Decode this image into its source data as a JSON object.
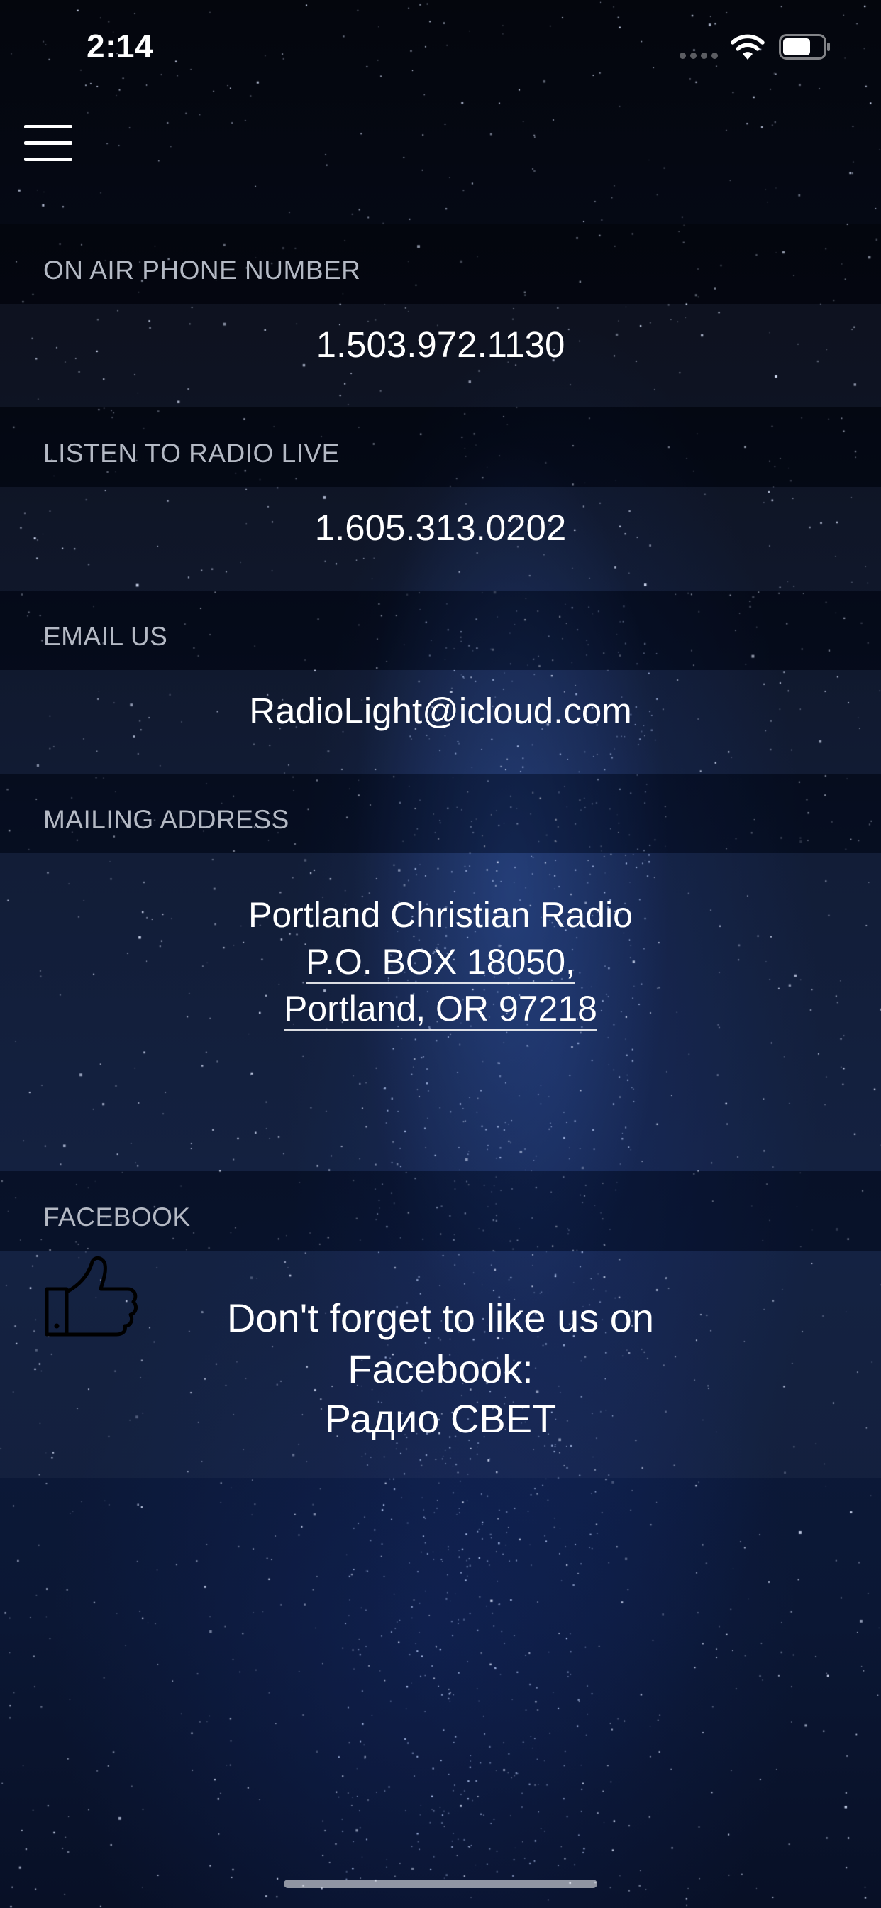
{
  "status_bar": {
    "time": "2:14"
  },
  "icons": {
    "menu": "hamburger-menu-icon",
    "wifi": "wifi-icon",
    "battery": "battery-icon",
    "thumbs_up": "thumbs-up-icon"
  },
  "sections": {
    "on_air_phone": {
      "label": "ON AIR PHONE NUMBER",
      "value": "1.503.972.1130"
    },
    "listen_live": {
      "label": "LISTEN TO RADIO LIVE",
      "value": "1.605.313.0202"
    },
    "email": {
      "label": "EMAIL US",
      "value": "RadioLight@icloud.com"
    },
    "mailing_address": {
      "label": "MAILING ADDRESS",
      "line1": "Portland Christian Radio",
      "line2": "P.O. BOX 18050,",
      "line3": "Portland, OR 97218"
    },
    "facebook": {
      "label": "FACEBOOK",
      "line1": "Don't forget to like us on",
      "line2": "Facebook:",
      "line3": "Радио СВЕТ"
    }
  },
  "colors": {
    "background_top": "#04060d",
    "background_mid": "#0c1a3c",
    "label_text": "#b4b9c4",
    "value_text": "#ffffff"
  }
}
